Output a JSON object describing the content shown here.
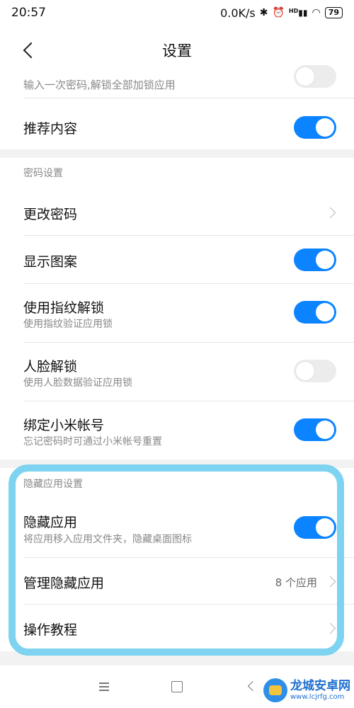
{
  "status_bar": {
    "time": "20:57",
    "network_speed": "0.0K/s",
    "icons": [
      "bluetooth-icon",
      "alarm-icon",
      "signal-icon",
      "wifi-icon"
    ],
    "signal_label": "HD",
    "battery": "79"
  },
  "header": {
    "title": "设置"
  },
  "partial_item": {
    "subtitle": "输入一次密码,解锁全部加锁应用",
    "toggle_on": false
  },
  "recommend": {
    "title": "推荐内容",
    "toggle_on": true
  },
  "password_section": {
    "header": "密码设置",
    "items": [
      {
        "title": "更改密码",
        "subtitle": "",
        "control": "chevron"
      },
      {
        "title": "显示图案",
        "subtitle": "",
        "control": "toggle",
        "toggle_on": true
      },
      {
        "title": "使用指纹解锁",
        "subtitle": "使用指纹验证应用锁",
        "control": "toggle",
        "toggle_on": true
      },
      {
        "title": "人脸解锁",
        "subtitle": "使用人脸数据验证应用锁",
        "control": "toggle",
        "toggle_on": false
      },
      {
        "title": "绑定小米帐号",
        "subtitle": "忘记密码时可通过小米帐号重置",
        "control": "toggle",
        "toggle_on": true
      }
    ]
  },
  "hidden_section": {
    "header": "隐藏应用设置",
    "items": [
      {
        "title": "隐藏应用",
        "subtitle": "将应用移入应用文件夹，隐藏桌面图标",
        "control": "toggle",
        "toggle_on": true
      },
      {
        "title": "管理隐藏应用",
        "subtitle": "",
        "control": "chevron",
        "value": "8 个应用"
      },
      {
        "title": "操作教程",
        "subtitle": "",
        "control": "chevron"
      }
    ]
  },
  "watermark": {
    "name": "龙城安卓网",
    "url": "www.lcjrfg.com"
  },
  "colors": {
    "accent": "#0d84ff",
    "highlight": "#7dd3f0",
    "background": "#f2f2f2"
  }
}
